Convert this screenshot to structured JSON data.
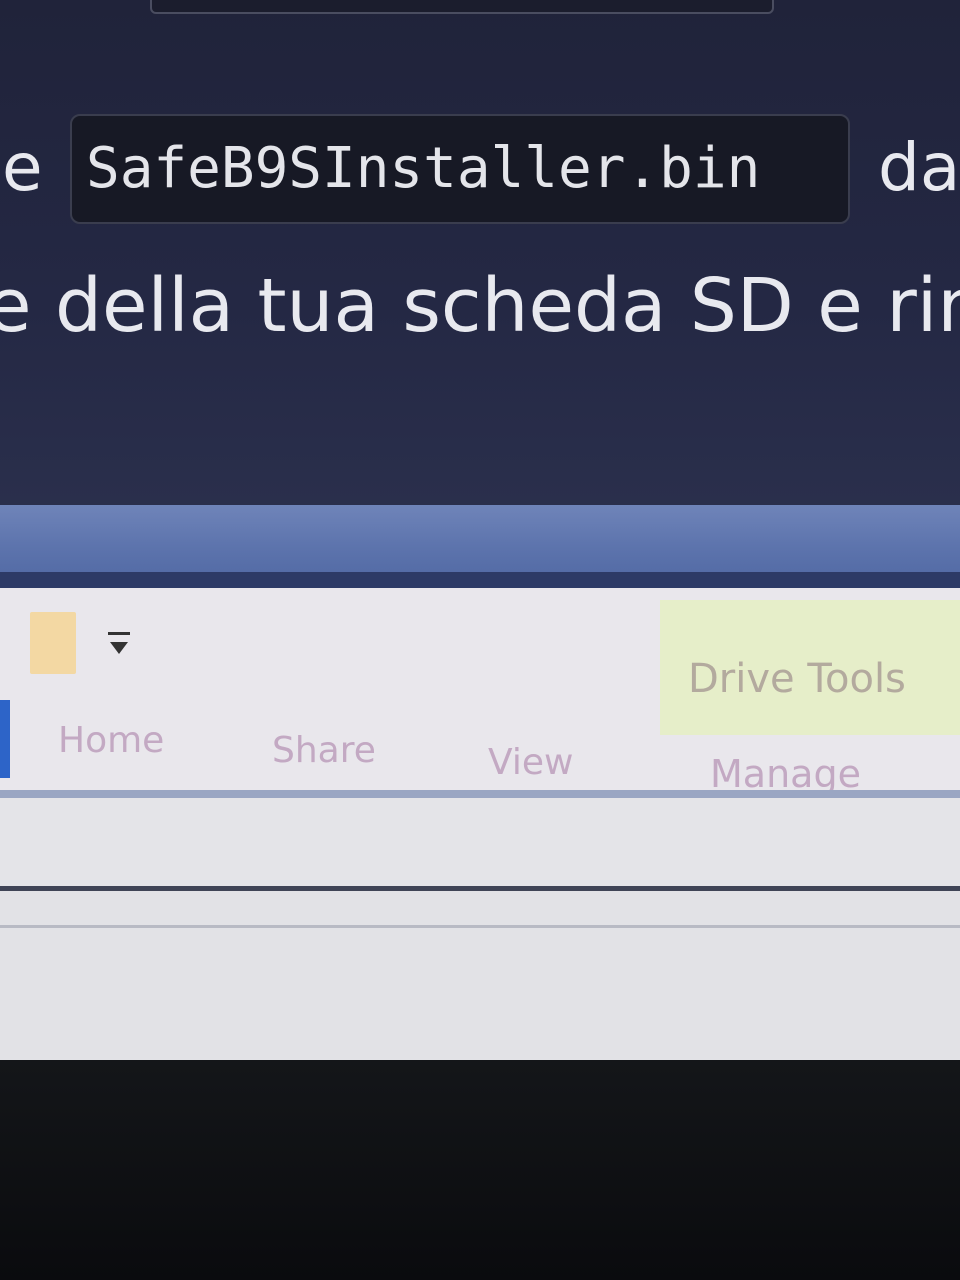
{
  "guide": {
    "line1_before": "e",
    "filename": "SafeB9SInstaller.bin",
    "line1_after": "da",
    "line2": "e della tua scheda SD e rin"
  },
  "explorer": {
    "contextual_tab_group": "Drive Tools",
    "tabs": [
      {
        "label": "Home"
      },
      {
        "label": "Share"
      },
      {
        "label": "View"
      },
      {
        "label": "Manage"
      }
    ],
    "icons": {
      "folder": "folder-icon",
      "quick_access_dropdown": "chevron-down-icon"
    }
  },
  "colors": {
    "page_bg": "#242844",
    "titlebar": "#5d74ad",
    "ribbon_bg": "#e9e7ec",
    "drive_tools_bg": "#e6eec9",
    "tab_text": "#c3a9c3"
  }
}
